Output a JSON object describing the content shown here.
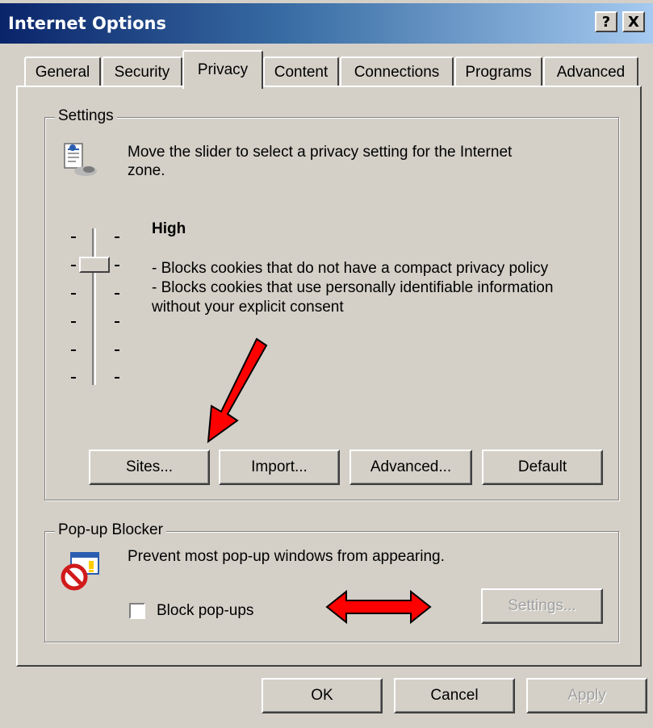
{
  "window": {
    "title": "Internet Options",
    "help_label": "?",
    "close_label": "X"
  },
  "tabs": [
    {
      "label": "General"
    },
    {
      "label": "Security"
    },
    {
      "label": "Privacy",
      "active": true
    },
    {
      "label": "Content"
    },
    {
      "label": "Connections"
    },
    {
      "label": "Programs"
    },
    {
      "label": "Advanced"
    }
  ],
  "settings": {
    "legend": "Settings",
    "description_line1": "Move the slider to select a privacy setting for the Internet",
    "description_line2": "zone.",
    "level": "High",
    "slider_position": "2 of 6 (from top)",
    "detail_line1": "- Blocks cookies that do not have a compact privacy policy",
    "detail_line2": "- Blocks cookies that use personally identifiable information",
    "detail_line3": "without your explicit consent",
    "buttons": {
      "sites": "Sites...",
      "import": "Import...",
      "advanced": "Advanced...",
      "default": "Default"
    }
  },
  "popup": {
    "legend": "Pop-up Blocker",
    "description": "Prevent most pop-up windows from appearing.",
    "checkbox_label": "Block pop-ups",
    "checkbox_checked": false,
    "settings_button": "Settings..."
  },
  "footer": {
    "ok": "OK",
    "cancel": "Cancel",
    "apply": "Apply"
  },
  "colors": {
    "titlebar_start": "#0a246a",
    "titlebar_end": "#a6caf0",
    "face": "#d4d0c8",
    "annotation_arrow": "#ff0000"
  }
}
